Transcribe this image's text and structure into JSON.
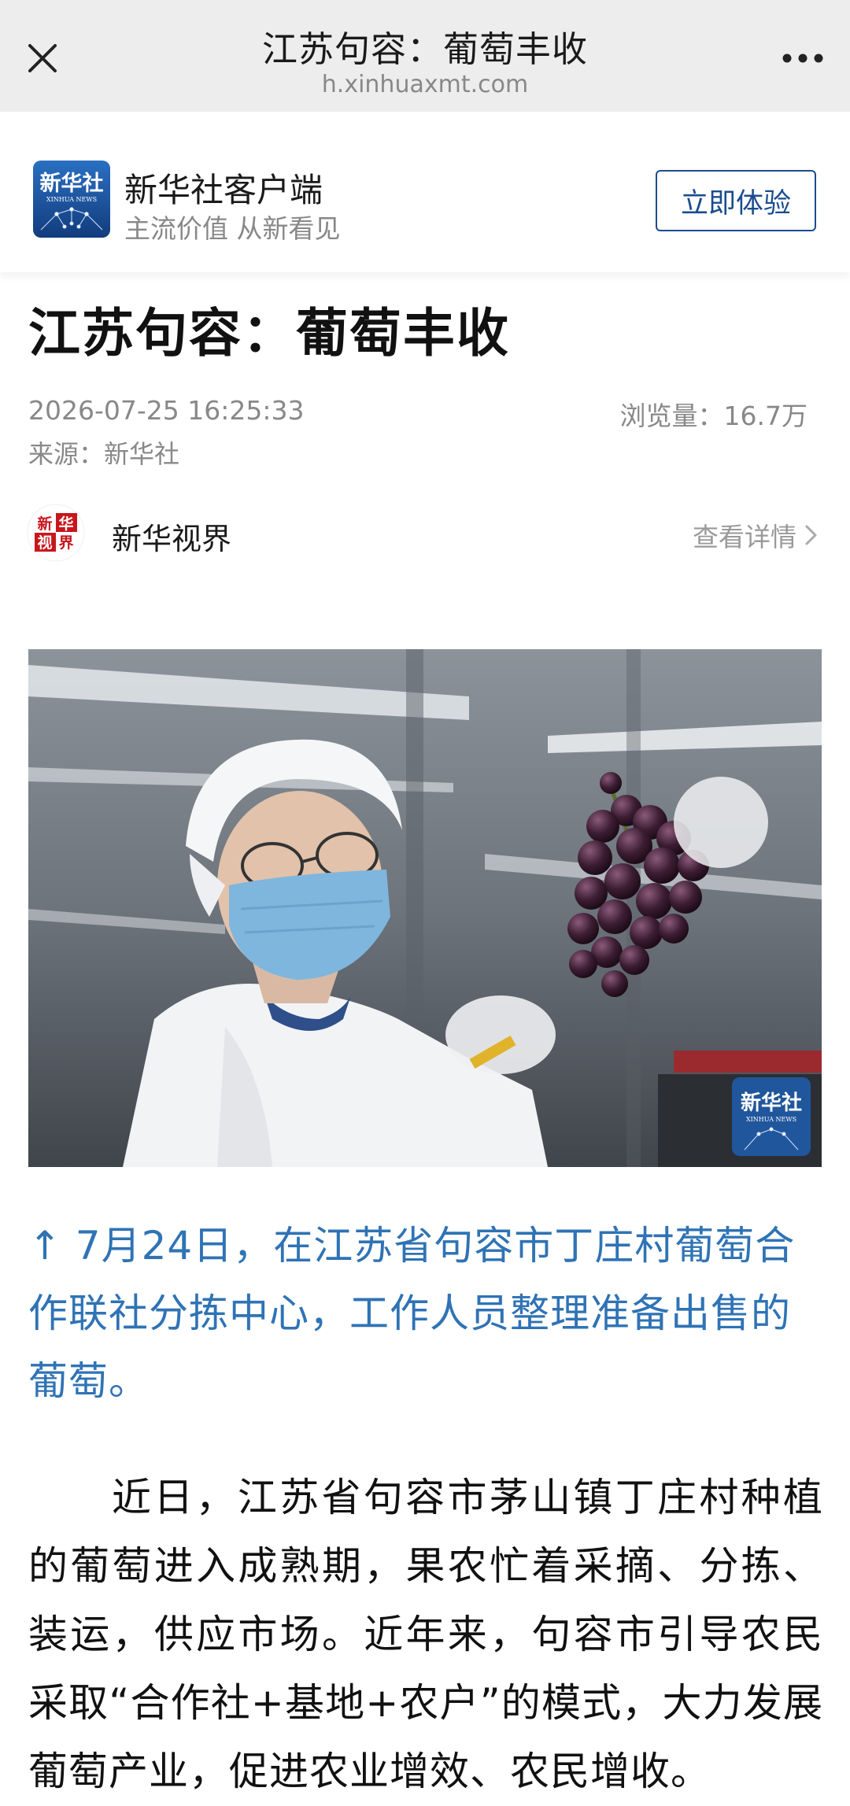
{
  "topbar": {
    "title": "江苏句容：葡萄丰收",
    "url": "h.xinhuaxmt.com"
  },
  "app_banner": {
    "name": "新华社客户端",
    "slogan": "主流价值 从新看见",
    "logo_text": "新华社",
    "logo_subtext": "XINHUA NEWS",
    "button_label": "立即体验"
  },
  "article": {
    "title": "江苏句容：葡萄丰收",
    "datetime": "2026-07-25 16:25:33",
    "views": "浏览量：16.7万",
    "source": "来源：新华社",
    "author": {
      "name": "新华视界",
      "avatar_text": "新华视界",
      "detail_label": "查看详情"
    },
    "photo_watermark": "新华社",
    "photo_watermark_sub": "XINHUA NEWS",
    "caption": "↑ 7月24日，在江苏省句容市丁庄村葡萄合作联社分拣中心，工作人员整理准备出售的葡萄。",
    "paragraph": "近日，江苏省句容市茅山镇丁庄村种植的葡萄进入成熟期，果农忙着采摘、分拣、装运，供应市场。近年来，句容市引导农民采取“合作社+基地+农户”的模式，大力发展葡萄产业，促进农业增效、农民增收。"
  },
  "colors": {
    "topbar_bg": "#ededed",
    "brand_blue": "#1a4c8f",
    "caption_blue": "#2f73b5",
    "avatar_red": "#c8161d"
  },
  "icons": {
    "close": "close-icon",
    "more": "more-dots-icon",
    "chevron": "chevron-right-icon"
  }
}
